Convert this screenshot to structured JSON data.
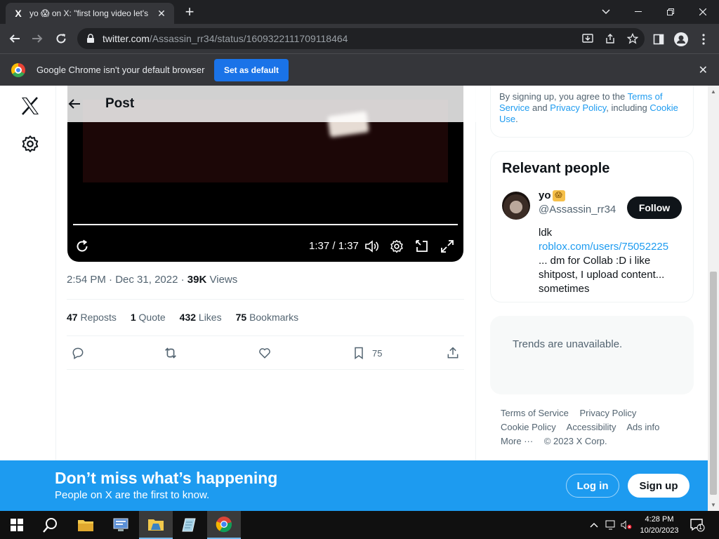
{
  "browser": {
    "tab_title": "yo 😱 on X: \"first long video let's",
    "tab_favicon": "X",
    "url_host": "twitter.com",
    "url_path": "/Assassin_rr34/status/1609322111709118464",
    "infobar_message": "Google Chrome isn't your default browser",
    "infobar_button": "Set as default"
  },
  "post_header": {
    "title": "Post"
  },
  "video": {
    "time": "1:37 / 1:37",
    "progress": 1.0
  },
  "post_meta": {
    "time": "2:54 PM",
    "date": "Dec 31, 2022",
    "views_count": "39K",
    "views_label": "Views"
  },
  "stats": {
    "reposts_count": "47",
    "reposts_label": "Reposts",
    "quote_count": "1",
    "quote_label": "Quote",
    "likes_count": "432",
    "likes_label": "Likes",
    "bookmarks_count": "75",
    "bookmarks_label": "Bookmarks"
  },
  "actions": {
    "bookmark_count": "75"
  },
  "legal": {
    "prefix": "By signing up, you agree to the ",
    "terms": "Terms of Service",
    "and": " and ",
    "privacy": "Privacy Policy",
    "including": ", including ",
    "cookie": "Cookie Use",
    "end": "."
  },
  "relevant_people": {
    "heading": "Relevant people",
    "name": "yo",
    "name_emoji": "😱",
    "handle": "@Assassin_rr34",
    "follow_label": "Follow",
    "bio_line1": "ldk",
    "bio_link": "roblox.com/users/75052225",
    "bio_rest": "... dm for Collab :D i like shitpost, I upload content... sometimes"
  },
  "trends": {
    "message": "Trends are unavailable."
  },
  "footer": {
    "terms": "Terms of Service",
    "privacy": "Privacy Policy",
    "cookie": "Cookie Policy",
    "accessibility": "Accessibility",
    "ads": "Ads info",
    "more": "More ···",
    "copyright": "© 2023 X Corp."
  },
  "banner": {
    "headline": "Don’t miss what’s happening",
    "subline": "People on X are the first to know.",
    "login": "Log in",
    "signup": "Sign up"
  },
  "taskbar": {
    "time": "4:28 PM",
    "date": "10/20/2023",
    "notif_count": "1"
  },
  "colors": {
    "accent": "#1d9bf0",
    "chrome_dark": "#202124",
    "chrome_toolbar": "#35363a",
    "chrome_button": "#1a73e8"
  }
}
